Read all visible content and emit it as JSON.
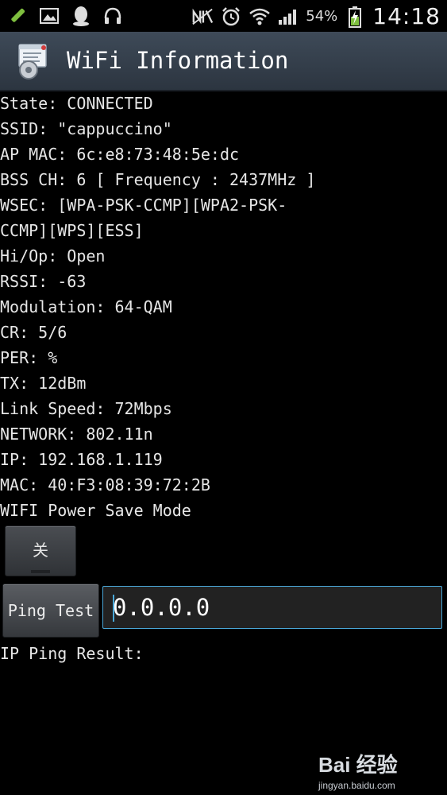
{
  "status_bar": {
    "battery_percent": "54%",
    "time": "14:18",
    "left_icons": [
      "edit-icon",
      "image-icon",
      "qq-icon",
      "headphones-icon"
    ],
    "right_icons": [
      "nfc-off-icon",
      "alarm-icon",
      "wifi-icon",
      "signal-icon",
      "battery-charging-icon"
    ]
  },
  "title_bar": {
    "title": "WiFi Information",
    "icon": "wifi-info-app-icon"
  },
  "info_lines": [
    "State: CONNECTED",
    "SSID: \"cappuccino\"",
    "AP MAC: 6c:e8:73:48:5e:dc",
    "BSS CH: 6  [ Frequency : 2437MHz ]",
    "WSEC: [WPA-PSK-CCMP][WPA2-PSK-",
    "CCMP][WPS][ESS]",
    "Hi/Op: Open",
    "RSSI: -63",
    "Modulation: 64-QAM",
    "CR: 5/6",
    "PER:  %",
    "TX: 12dBm",
    "Link Speed: 72Mbps",
    "NETWORK: 802.11n",
    "IP: 192.168.1.119",
    "MAC: 40:F3:08:39:72:2B",
    "WIFI Power Save Mode"
  ],
  "power_save_toggle": {
    "label": "关"
  },
  "ping": {
    "button_label": "Ping Test",
    "input_value": "0.0.0.0",
    "result_label": "IP Ping Result:"
  },
  "watermark": {
    "main": "Bai 经验",
    "sub": "jingyan.baidu.com"
  },
  "colors": {
    "background": "#000000",
    "titlebar": "#36404b",
    "accent": "#4aa8d8",
    "text": "#e6e6e6"
  }
}
